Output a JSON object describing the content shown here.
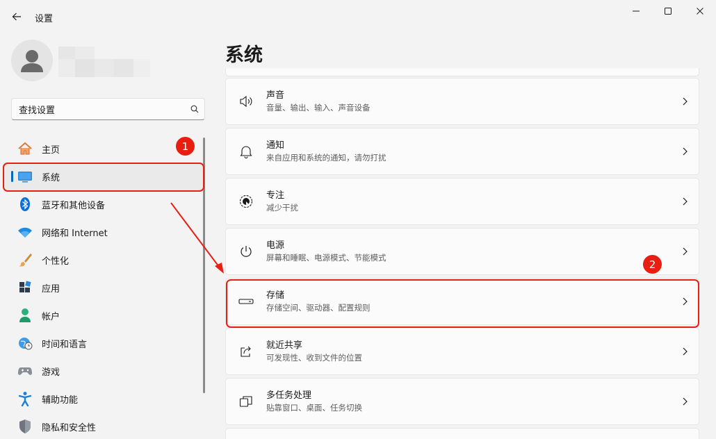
{
  "window": {
    "title": "设置",
    "controls": [
      "minimize-icon",
      "maximize-icon",
      "close-icon"
    ]
  },
  "search": {
    "placeholder": "查找设置"
  },
  "sidebar": {
    "items": [
      {
        "label": "主页",
        "icon": "home-icon"
      },
      {
        "label": "系统",
        "icon": "monitor-icon",
        "selected": true
      },
      {
        "label": "蓝牙和其他设备",
        "icon": "bluetooth-icon"
      },
      {
        "label": "网络和 Internet",
        "icon": "wifi-icon"
      },
      {
        "label": "个性化",
        "icon": "paintbrush-icon"
      },
      {
        "label": "应用",
        "icon": "apps-icon"
      },
      {
        "label": "帐户",
        "icon": "account-icon"
      },
      {
        "label": "时间和语言",
        "icon": "globe-clock-icon"
      },
      {
        "label": "游戏",
        "icon": "gamepad-icon"
      },
      {
        "label": "辅助功能",
        "icon": "accessibility-icon"
      },
      {
        "label": "隐私和安全性",
        "icon": "shield-icon"
      }
    ]
  },
  "main": {
    "title": "系统",
    "cards": [
      {
        "title": "声音",
        "subtitle": "音量、输出、输入、声音设备",
        "icon": "speaker-icon"
      },
      {
        "title": "通知",
        "subtitle": "来自应用和系统的通知，请勿打扰",
        "icon": "bell-icon"
      },
      {
        "title": "专注",
        "subtitle": "减少干扰",
        "icon": "focus-icon"
      },
      {
        "title": "电源",
        "subtitle": "屏幕和睡眠、电源模式、节能模式",
        "icon": "power-icon"
      },
      {
        "title": "存储",
        "subtitle": "存储空间、驱动器、配置规则",
        "icon": "storage-drive-icon"
      },
      {
        "title": "就近共享",
        "subtitle": "可发现性、收到文件的位置",
        "icon": "share-icon"
      },
      {
        "title": "多任务处理",
        "subtitle": "贴靠窗口、桌面、任务切换",
        "icon": "multitasking-icon"
      }
    ]
  },
  "annotations": {
    "badge1": "1",
    "badge2": "2",
    "color": "#e81e10"
  },
  "colors": {
    "accent": "#0067c0",
    "background": "#f3f3f3"
  }
}
